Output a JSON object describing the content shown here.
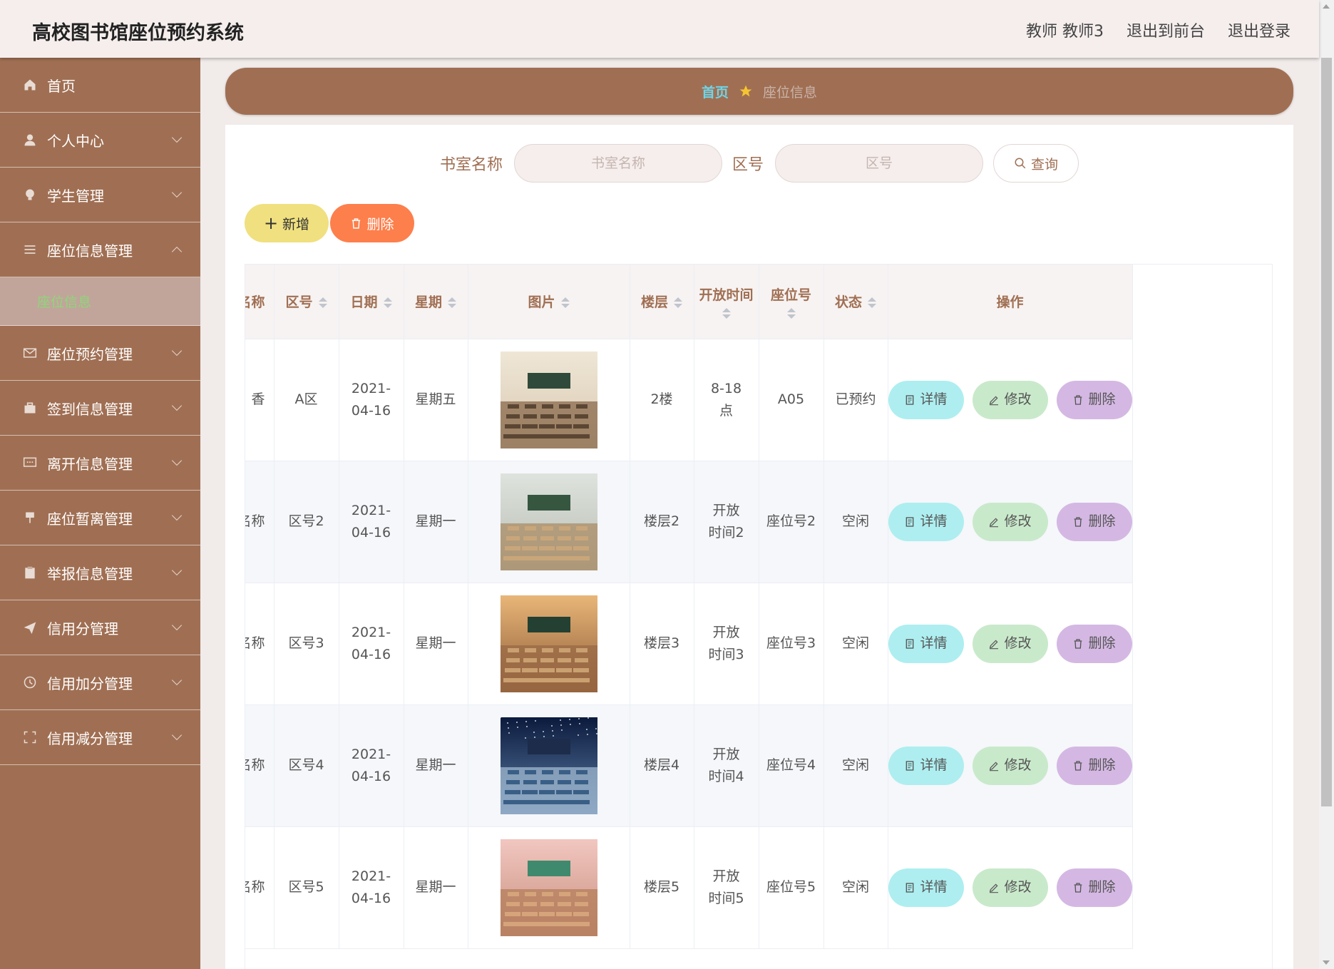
{
  "header": {
    "title": "高校图书馆座位预约系统",
    "user": "教师 教师3",
    "to_front": "退出到前台",
    "logout": "退出登录"
  },
  "sidebar": {
    "items": [
      {
        "label": "首页",
        "icon": "home-icon"
      },
      {
        "label": "个人中心",
        "icon": "user-icon"
      },
      {
        "label": "学生管理",
        "icon": "bulb-icon"
      },
      {
        "label": "座位信息管理",
        "icon": "menu-icon",
        "expanded": true
      },
      {
        "label": "座位预约管理",
        "icon": "mail-icon"
      },
      {
        "label": "签到信息管理",
        "icon": "suitcase-icon"
      },
      {
        "label": "离开信息管理",
        "icon": "chat-icon"
      },
      {
        "label": "座位暂离管理",
        "icon": "pin-icon"
      },
      {
        "label": "举报信息管理",
        "icon": "clipboard-icon"
      },
      {
        "label": "信用分管理",
        "icon": "send-icon"
      },
      {
        "label": "信用加分管理",
        "icon": "clock-icon"
      },
      {
        "label": "信用减分管理",
        "icon": "fullscreen-icon"
      }
    ],
    "active_sub": "座位信息"
  },
  "breadcrumb": {
    "home": "首页",
    "current": "座位信息"
  },
  "search": {
    "room_label": "书室名称",
    "room_placeholder": "书室名称",
    "area_label": "区号",
    "area_placeholder": "区号",
    "query": "查询"
  },
  "actions": {
    "add": "新增",
    "delete": "删除"
  },
  "table": {
    "columns": [
      "名称",
      "区号",
      "日期",
      "星期",
      "图片",
      "楼层",
      "开放时间",
      "座位号",
      "状态",
      "操作"
    ],
    "rows": [
      {
        "name": "香",
        "area": "A区",
        "date": "2021-04-16",
        "week": "星期五",
        "floor": "2楼",
        "open": "8-18点",
        "seat": "A05",
        "status": "已预约"
      },
      {
        "name": "名称",
        "area": "区号2",
        "date": "2021-04-16",
        "week": "星期一",
        "floor": "楼层2",
        "open": "开放时间2",
        "seat": "座位号2",
        "status": "空闲"
      },
      {
        "name": "名称",
        "area": "区号3",
        "date": "2021-04-16",
        "week": "星期一",
        "floor": "楼层3",
        "open": "开放时间3",
        "seat": "座位号3",
        "status": "空闲"
      },
      {
        "name": "名称",
        "area": "区号4",
        "date": "2021-04-16",
        "week": "星期一",
        "floor": "楼层4",
        "open": "开放时间4",
        "seat": "座位号4",
        "status": "空闲"
      },
      {
        "name": "名称",
        "area": "区号5",
        "date": "2021-04-16",
        "week": "星期一",
        "floor": "楼层5",
        "open": "开放时间5",
        "seat": "座位号5",
        "status": "空闲"
      }
    ],
    "ops": {
      "detail": "详情",
      "edit": "修改",
      "remove": "删除"
    }
  },
  "colors": {
    "brand": "#a06f53",
    "header_bg": "#f5eeed",
    "active_sub_text": "#8fd67a",
    "crumb_home": "#6fd5e8",
    "add_btn": "#f0e07f",
    "delete_btn": "#fd7f4c"
  }
}
